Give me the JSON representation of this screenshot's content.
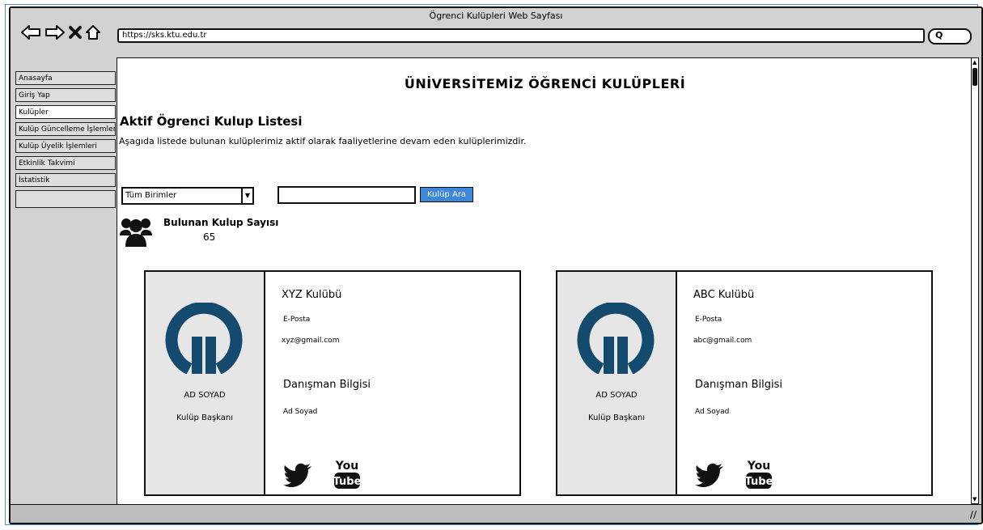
{
  "window": {
    "title": "Ögrenci Kulüpleri Web Sayfası",
    "url": "https://sks.ktu.edu.tr",
    "search_glyph": "Q"
  },
  "sidebar": {
    "items": [
      {
        "label": "Anasayfa"
      },
      {
        "label": "Giriş Yap"
      },
      {
        "label": "Kulüpler"
      },
      {
        "label": "Kulüp Güncelleme İşlemleri"
      },
      {
        "label": "Kulüp Üyelik İşlemleri"
      },
      {
        "label": "Etkinlik Takvimi"
      },
      {
        "label": "İstatistik"
      },
      {
        "label": ""
      }
    ],
    "active_index": 2
  },
  "main": {
    "page_title": "ÜNİVERSİTEMİZ ÖĞRENCİ KULÜPLERİ",
    "section_title": "Aktif Ögrenci Kulup Listesi",
    "section_desc": "Aşagıda listede bulunan kulüplerimiz aktif olarak faaliyetlerine devam eden kulüplerimizdir.",
    "filter": {
      "selected": "Tüm Birimler",
      "search_value": "",
      "search_button": "Kulüp Ara"
    },
    "count": {
      "label": "Bulunan Kulup Sayısı",
      "value": "65"
    },
    "clubs": [
      {
        "name": "XYZ Kulübü",
        "email_label": "E-Posta",
        "email": "xyz@gmail.com",
        "advisor_title": "Danışman Bilgisi",
        "advisor_name": "Ad Soyad",
        "president_name": "AD SOYAD",
        "president_role": "Kulüp Başkanı"
      },
      {
        "name": "ABC Kulübü",
        "email_label": "E-Posta",
        "email": "abc@gmail.com",
        "advisor_title": "Danışman Bilgisi",
        "advisor_name": "Ad Soyad",
        "president_name": "AD SOYAD",
        "president_role": "Kulüp Başkanı"
      }
    ],
    "youtube_text": {
      "top": "You",
      "bottom": "Tube"
    }
  },
  "colors": {
    "logo": "#134a6e",
    "button": "#3d87d6",
    "frame_accent": "#4f8ac9"
  },
  "icons": [
    "back-arrow-icon",
    "forward-arrow-icon",
    "close-icon",
    "home-icon",
    "search-icon",
    "users-icon",
    "twitter-icon",
    "youtube-icon"
  ]
}
